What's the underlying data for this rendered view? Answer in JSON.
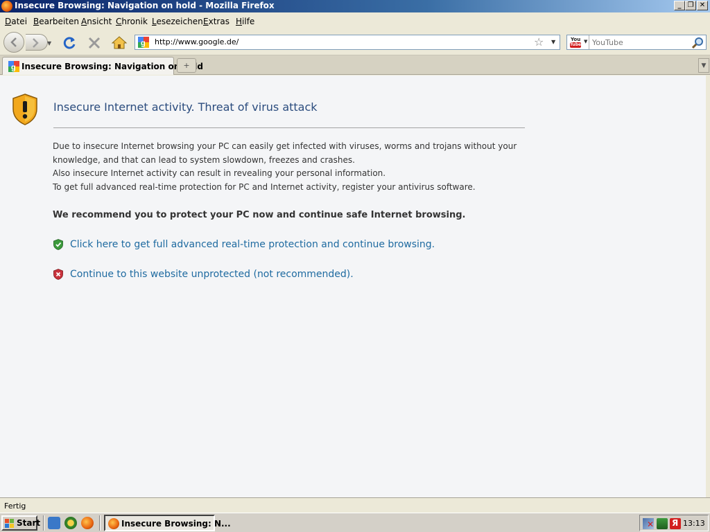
{
  "window": {
    "title": "Insecure Browsing: Navigation on hold - Mozilla Firefox",
    "controls": {
      "minimize": "_",
      "restore": "❐",
      "close": "✕"
    }
  },
  "menubar": {
    "items": [
      "Datei",
      "Bearbeiten",
      "Ansicht",
      "Chronik",
      "Lesezeichen",
      "Extras",
      "Hilfe"
    ]
  },
  "navbar": {
    "url": "http://www.google.de/",
    "search_placeholder": "YouTube",
    "icons": {
      "back": "back-arrow-icon",
      "forward": "forward-arrow-icon",
      "reload": "reload-icon",
      "stop": "stop-icon",
      "home": "home-icon",
      "bookmark": "star-icon",
      "search_engine": "youtube-icon",
      "search": "magnifier-icon"
    }
  },
  "tabs": [
    {
      "label": "Insecure Browsing: Navigation on hold",
      "active": true
    }
  ],
  "newtab_label": "+",
  "page": {
    "heading": "Insecure Internet activity. Threat of virus attack",
    "paragraph_lines": [
      "Due to insecure Internet browsing your PC can easily get infected with viruses, worms and trojans without your",
      "knowledge, and that can lead to system slowdown, freezes and crashes.",
      "Also insecure Internet activity can result in revealing your personal information.",
      "To get full advanced real-time protection for PC and Internet activity, register your antivirus software."
    ],
    "recommendation": "We recommend you to protect your PC now and continue safe Internet browsing.",
    "links": {
      "protect": "Click here to get full advanced real-time protection and continue browsing.",
      "unprotected": "Continue to this website unprotected (not recommended)."
    },
    "colors": {
      "heading": "#2b4c7e",
      "link": "#1e6aa0",
      "ok_shield": "#3c9a3c",
      "bad_shield": "#c8323c",
      "warning_shield": "#f2a81d"
    }
  },
  "statusbar": {
    "text": "Fertig"
  },
  "taskbar": {
    "start_label": "Start",
    "task_label": "Insecure Browsing: N...",
    "clock": "13:13"
  }
}
